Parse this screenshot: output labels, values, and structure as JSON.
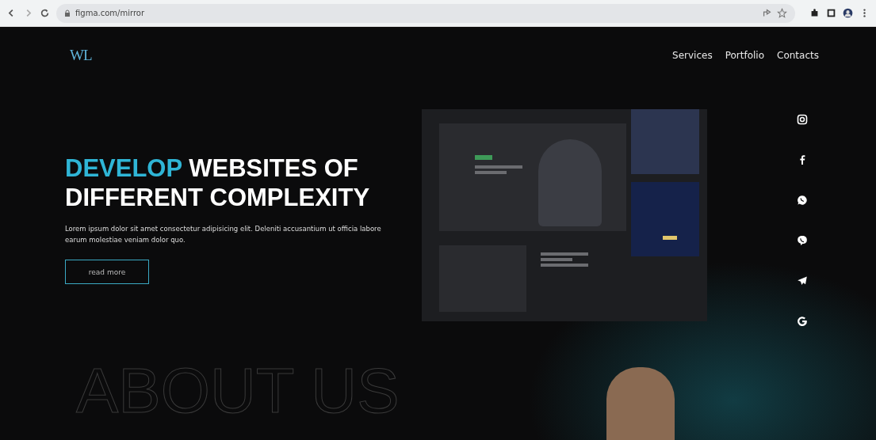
{
  "browser": {
    "url": "figma.com/mirror"
  },
  "nav": {
    "logo": "WL",
    "links": [
      {
        "label": "Services"
      },
      {
        "label": "Portfolio"
      },
      {
        "label": "Contacts"
      }
    ]
  },
  "hero": {
    "title_accent": "DEVELOP",
    "title_rest": "WEBSITES OF DIFFERENT COMPLEXITY",
    "text": "Lorem ipsum dolor sit amet consectetur adipisicing elit. Deleniti accusantium ut officia labore earum molestiae veniam dolor quo.",
    "button": "read more"
  },
  "social": [
    {
      "kind": "instagram"
    },
    {
      "kind": "facebook"
    },
    {
      "kind": "whatsapp"
    },
    {
      "kind": "viber"
    },
    {
      "kind": "telegram"
    },
    {
      "kind": "google"
    }
  ],
  "about": {
    "title": "ABOUT US"
  }
}
